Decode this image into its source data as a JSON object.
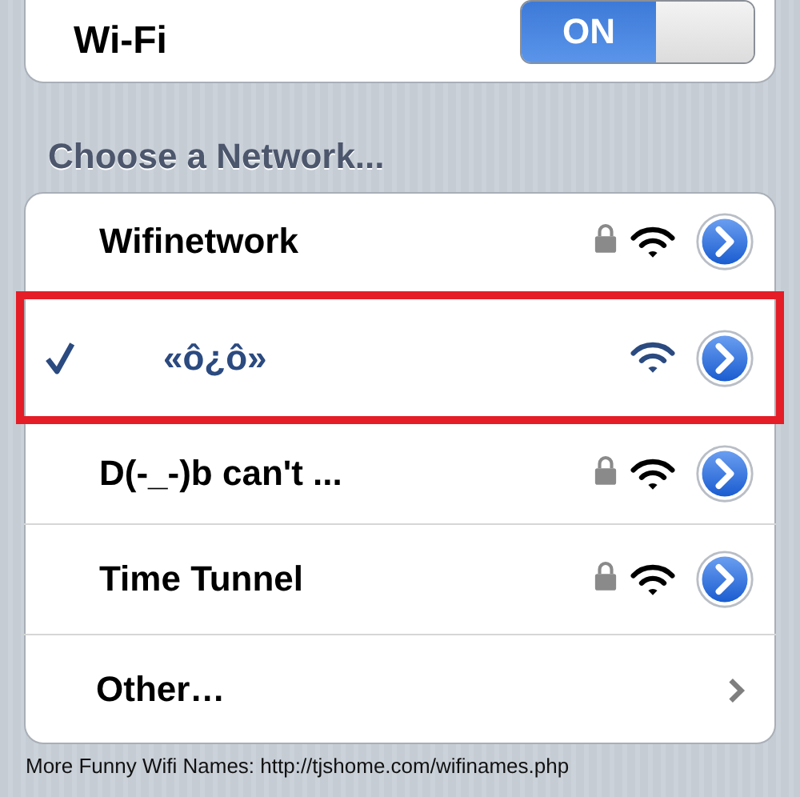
{
  "wifi": {
    "label": "Wi-Fi",
    "on": true,
    "on_text": "ON"
  },
  "section_title": "Choose a Network...",
  "networks": [
    {
      "kind": "network",
      "name": "Wifinetwork",
      "selected": false,
      "locked": true,
      "highlighted": false
    },
    {
      "kind": "network",
      "name": "«ô¿ô»",
      "selected": true,
      "locked": false,
      "highlighted": true
    },
    {
      "kind": "network",
      "name": "D(-_-)b can't ...",
      "selected": false,
      "locked": true,
      "highlighted": false
    },
    {
      "kind": "network",
      "name": "Time Tunnel",
      "selected": false,
      "locked": true,
      "highlighted": false
    },
    {
      "kind": "other",
      "name": "Other…"
    }
  ],
  "caption": "More Funny Wifi Names: http://tjshome.com/wifinames.php"
}
